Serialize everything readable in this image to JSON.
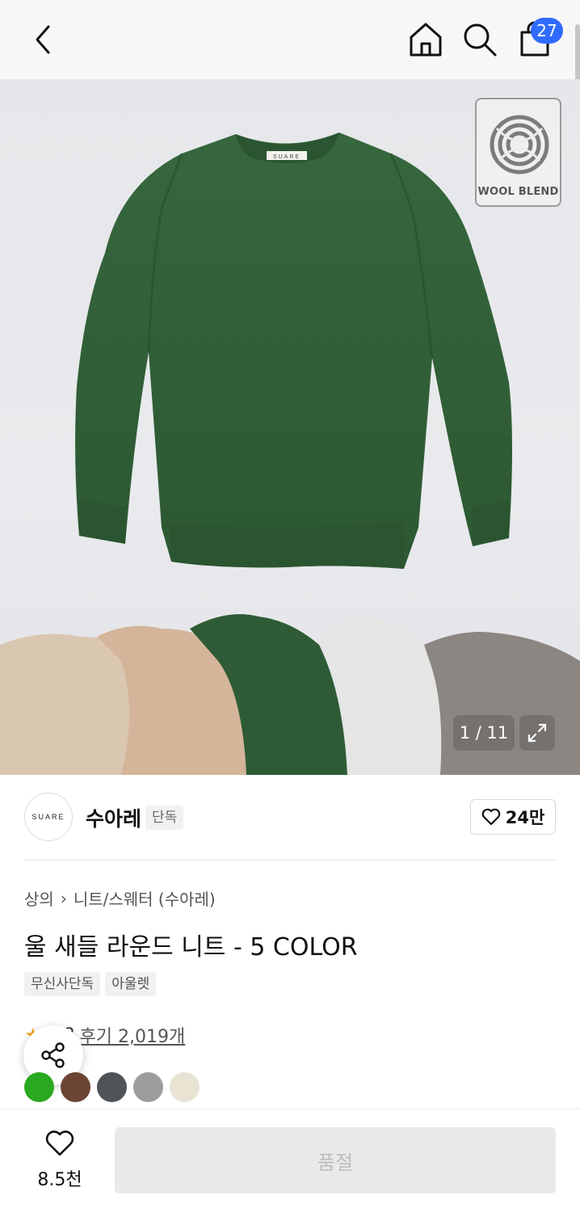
{
  "header": {
    "back_icon": "chevron-left-icon",
    "home_icon": "home-icon",
    "search_icon": "search-icon",
    "cart_icon": "shopping-bag-icon",
    "cart_count": "27"
  },
  "gallery": {
    "badge_label": "WOOL BLEND",
    "sweater_label": "SUARE",
    "counter": "1 / 11",
    "expand_icon": "expand-icon",
    "main_color": "#2f5e36",
    "swatch_colors_in_photo": [
      "#d8c6b1",
      "#d2b499",
      "#2e5a34",
      "#e4e4e2",
      "#8a8581"
    ]
  },
  "brand": {
    "logo_text": "SUARE",
    "name": "수아레",
    "tag": "단독",
    "like_icon": "heart-outline-icon",
    "likes": "24만"
  },
  "product": {
    "breadcrumb": [
      "상의",
      "니트/스웨터 (수아레)"
    ],
    "title": "울 새들 라운드 니트 - 5 COLOR",
    "tags": [
      "무신사단독",
      "아울렛"
    ],
    "rating": "4.8",
    "review_label": "후기 2,019개",
    "star_icon": "star-icon"
  },
  "share": {
    "icon": "share-icon"
  },
  "colors": [
    {
      "hex": "#2aa81f"
    },
    {
      "hex": "#6b4433"
    },
    {
      "hex": "#505459"
    },
    {
      "hex": "#9d9d9d"
    },
    {
      "hex": "#e8e3d3"
    }
  ],
  "bottom": {
    "like_icon": "heart-outline-icon",
    "like_count": "8.5천",
    "buy_label": "품절"
  }
}
